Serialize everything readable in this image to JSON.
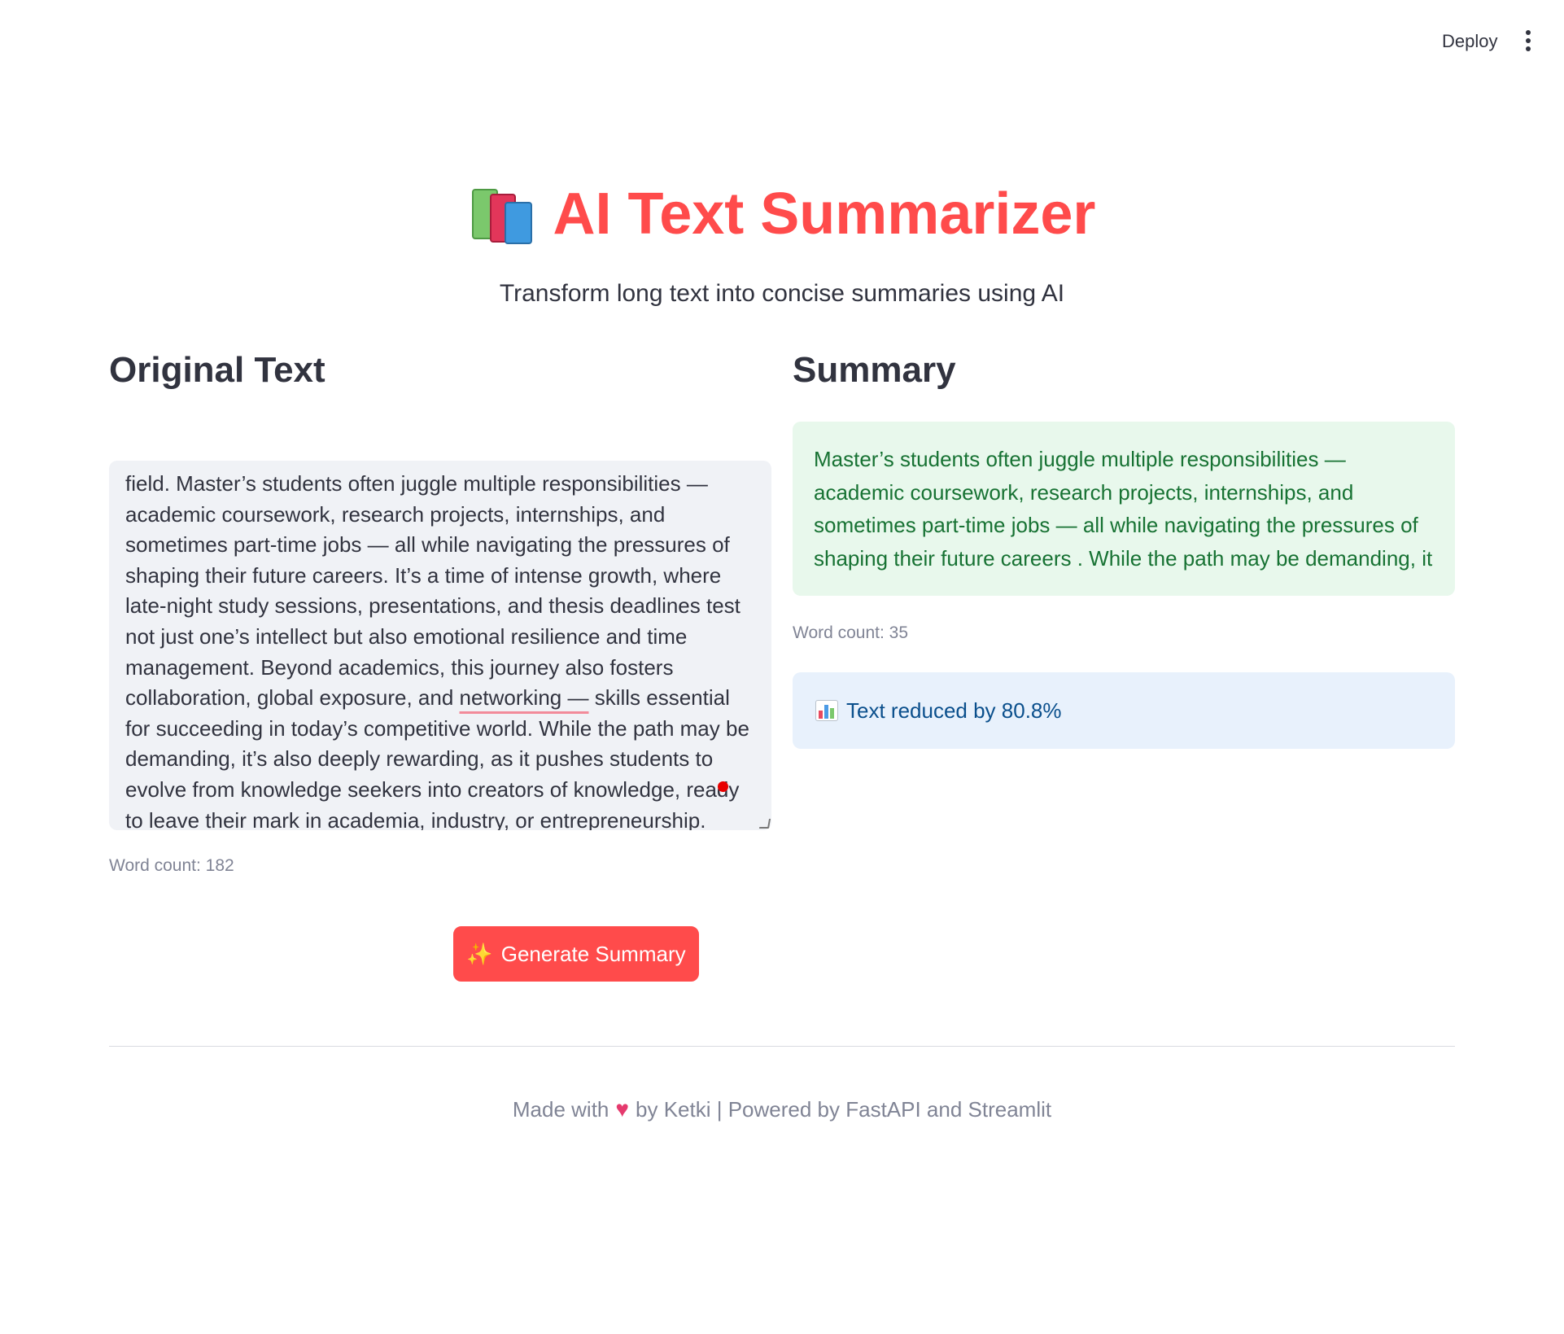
{
  "topbar": {
    "deploy_label": "Deploy",
    "menu_icon": "vertical-ellipsis-icon"
  },
  "header": {
    "icon": "books-icon",
    "title": "AI Text Summarizer",
    "subtitle": "Transform long text into concise summaries using AI"
  },
  "original": {
    "heading": "Original Text",
    "text_part1": "field. Master’s students often juggle multiple responsibilities — academic coursework, research projects, internships, and sometimes part-time jobs — all while navigating the pressures of shaping their future careers. It’s a time of intense growth, where late-night study sessions, presentations, and thesis deadlines test not just one’s intellect but also emotional resilience and time management. Beyond academics, this journey also fosters collaboration, global exposure, and ",
    "text_flagged": "networking —",
    "text_part2": " skills essential for succeeding in today’s competitive world. While the path may be demanding, it’s also deeply rewarding, as it pushes students to evolve from knowledge seekers into creators of knowledge, ready to leave their mark in academia, industry, or entrepreneurship.",
    "word_count": "Word count: 182",
    "generate_label": "Generate Summary",
    "generate_icon": "sparkles-icon"
  },
  "summary": {
    "heading": "Summary",
    "text": "Master’s students often juggle multiple responsibilities — academic coursework, research projects, internships, and sometimes part-time jobs — all while navigating the pressures of shaping their future careers . While the path may be demanding, it",
    "word_count": "Word count: 35",
    "reduction_text": "Text reduced by 80.8%",
    "reduction_icon": "bar-chart-icon"
  },
  "footer": {
    "made_with": "Made with",
    "by_text": "by Ketki | Powered by FastAPI and Streamlit"
  },
  "colors": {
    "primary": "#ff4b4b",
    "success_bg": "#e8f8ec",
    "success_text": "#177233",
    "info_bg": "#e8f1fc",
    "info_text": "#0a4f8c",
    "input_bg": "#f0f2f6"
  }
}
